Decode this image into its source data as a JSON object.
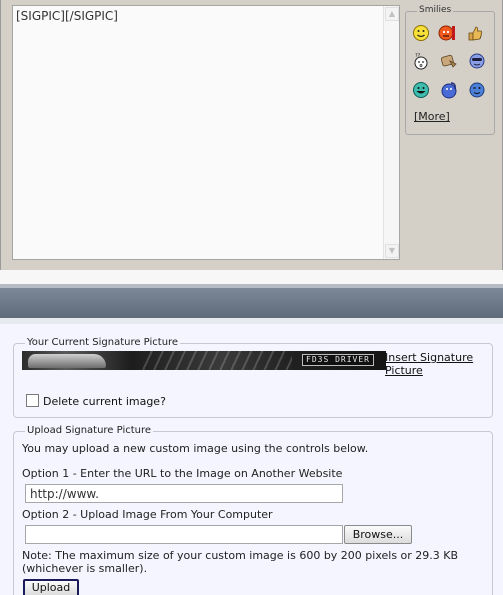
{
  "editor": {
    "content": "[SIGPIC][/SIGPIC]",
    "scroll_up": "▲",
    "scroll_down": "▼"
  },
  "smilies": {
    "legend": "Smilies",
    "more_label": "[More]",
    "icons": [
      "smile-icon",
      "mad-icon",
      "thumbs-up-icon",
      "confused-icon",
      "frustrated-icon",
      "eek-icon",
      "biggrin-icon",
      "rolleyes-icon",
      "wink-icon"
    ]
  },
  "current_sig": {
    "legend": "Your Current Signature Picture",
    "banner_text": "FD3S DRIVER",
    "insert_link": "Insert Signature Picture",
    "delete_label": "Delete current image?"
  },
  "upload": {
    "legend": "Upload Signature Picture",
    "intro": "You may upload a new custom image using the controls below.",
    "option1_label": "Option 1 - Enter the URL to the Image on Another Website",
    "url_value": "http://www.",
    "option2_label": "Option 2 - Upload Image From Your Computer",
    "file_value": "",
    "browse_label": "Browse...",
    "note": "Note: The maximum size of your custom image is 600 by 200 pixels or 29.3 KB (whichever is smaller).",
    "upload_label": "Upload"
  }
}
